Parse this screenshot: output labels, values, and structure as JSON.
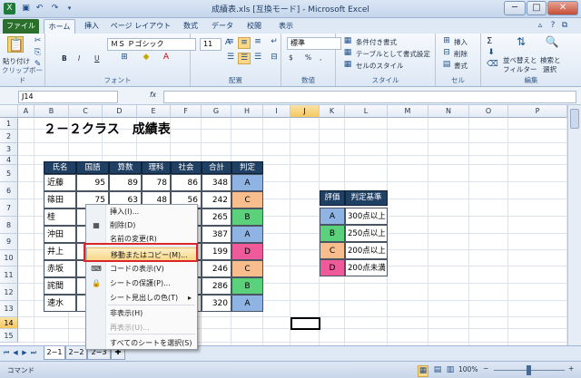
{
  "window": {
    "title": "成績表.xls [互換モード] - Microsoft Excel",
    "min": "─",
    "max": "□",
    "close": "✕"
  },
  "qat": [
    "save-icon",
    "undo-icon",
    "redo-icon"
  ],
  "tabs": {
    "file": "ファイル",
    "home": "ホーム",
    "insert": "挿入",
    "layout": "ページ レイアウト",
    "formulas": "数式",
    "data": "データ",
    "review": "校閲",
    "view": "表示"
  },
  "ribbon": {
    "clipboard": {
      "paste": "貼り付け",
      "label": "クリップボード"
    },
    "font": {
      "name": "ＭＳ Ｐゴシック",
      "size": "11",
      "bold": "B",
      "italic": "I",
      "underline": "U",
      "label": "フォント",
      "grow": "A",
      "shrink": "A"
    },
    "alignment": {
      "label": "配置"
    },
    "number": {
      "format": "標準",
      "label": "数値",
      "currency": "$",
      "percent": "%",
      "comma": ","
    },
    "styles": {
      "conditional": "条件付き書式",
      "table": "テーブルとして書式設定",
      "cell": "セルのスタイル",
      "label": "スタイル"
    },
    "cells": {
      "insert": "挿入",
      "delete": "削除",
      "format": "書式",
      "label": "セル"
    },
    "editing": {
      "sort": "並べ替えと\nフィルター",
      "sort1": "並べ替えと",
      "sort2": "フィルター",
      "find1": "検索と",
      "find2": "選択",
      "label": "編集",
      "sigma": "Σ"
    }
  },
  "formula_bar": {
    "namebox": "J14",
    "fx": "fx",
    "value": ""
  },
  "columns": [
    "A",
    "B",
    "C",
    "D",
    "E",
    "F",
    "G",
    "H",
    "I",
    "J",
    "K",
    "L",
    "M",
    "N",
    "O",
    "P"
  ],
  "rows": [
    "1",
    "2",
    "3",
    "4",
    "5",
    "6",
    "7",
    "8",
    "9",
    "10",
    "11",
    "12",
    "13",
    "14",
    "15"
  ],
  "sheet_title": "２－２クラス　成績表",
  "table": {
    "headers": [
      "氏名",
      "国語",
      "算数",
      "理科",
      "社会",
      "合計",
      "判定"
    ],
    "rows": [
      {
        "name": "近藤",
        "kokugo": "95",
        "sansu": "89",
        "rika": "78",
        "shakai": "86",
        "total": "348",
        "grade": "A"
      },
      {
        "name": "篠田",
        "kokugo": "75",
        "sansu": "63",
        "rika": "48",
        "shakai": "56",
        "total": "242",
        "grade": "C"
      },
      {
        "name": "桂",
        "kokugo": "",
        "sansu": "",
        "rika": "",
        "shakai": "",
        "total": "265",
        "grade": "B"
      },
      {
        "name": "沖田",
        "kokugo": "",
        "sansu": "",
        "rika": "",
        "shakai": "",
        "total": "387",
        "grade": "A"
      },
      {
        "name": "井上",
        "kokugo": "",
        "sansu": "",
        "rika": "",
        "shakai": "",
        "total": "199",
        "grade": "D"
      },
      {
        "name": "赤坂",
        "kokugo": "",
        "sansu": "",
        "rika": "",
        "shakai": "",
        "total": "246",
        "grade": "C"
      },
      {
        "name": "詫間",
        "kokugo": "",
        "sansu": "",
        "rika": "",
        "shakai": "",
        "total": "286",
        "grade": "B"
      },
      {
        "name": "速水",
        "kokugo": "",
        "sansu": "",
        "rika": "",
        "shakai": "",
        "total": "320",
        "grade": "A"
      }
    ]
  },
  "criteria": {
    "headers": [
      "評価",
      "判定基準"
    ],
    "rows": [
      {
        "grade": "A",
        "rule": "300点以上"
      },
      {
        "grade": "B",
        "rule": "250点以上"
      },
      {
        "grade": "C",
        "rule": "200点以上"
      },
      {
        "grade": "D",
        "rule": "200点未満"
      }
    ]
  },
  "grade_colors": {
    "A": "#8fb4e3",
    "B": "#5cd17c",
    "C": "#f7bd8c",
    "D": "#ee5a9a"
  },
  "context_menu": {
    "items": [
      {
        "label": "挿入(I)...",
        "icon": "",
        "disabled": false
      },
      {
        "label": "削除(D)",
        "icon": "delete-sheet-icon",
        "disabled": false
      },
      {
        "label": "名前の変更(R)",
        "icon": "",
        "disabled": false
      },
      {
        "label": "移動またはコピー(M)...",
        "icon": "",
        "disabled": false,
        "highlight": true
      },
      {
        "label": "コードの表示(V)",
        "icon": "view-code-icon",
        "disabled": false
      },
      {
        "label": "シートの保護(P)...",
        "icon": "protect-sheet-icon",
        "disabled": false
      },
      {
        "label": "シート見出しの色(T)",
        "icon": "",
        "disabled": false,
        "submenu": "▸"
      },
      {
        "label": "非表示(H)",
        "icon": "",
        "disabled": false
      },
      {
        "label": "再表示(U)...",
        "icon": "",
        "disabled": true
      },
      {
        "label": "すべてのシートを選択(S)",
        "icon": "",
        "disabled": false
      }
    ]
  },
  "sheets": [
    "2−1",
    "2−2",
    "2−3"
  ],
  "status": {
    "mode": "コマンド",
    "zoom": "100%",
    "minus": "−",
    "plus": "+"
  }
}
